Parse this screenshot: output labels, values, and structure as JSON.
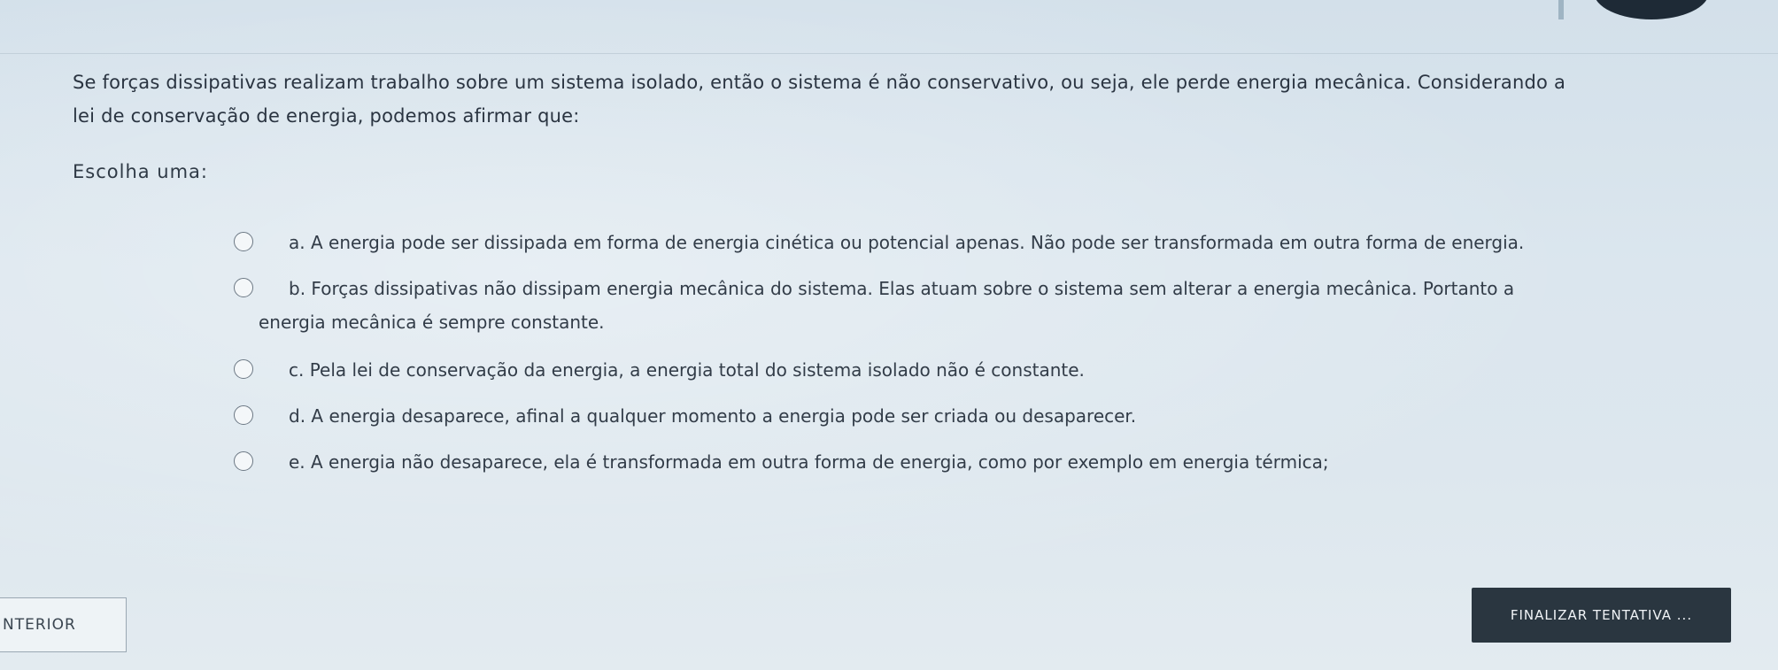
{
  "question": {
    "text_line1": "Se forças dissipativas realizam trabalho sobre um sistema isolado, então o sistema é não conservativo, ou seja, ele perde energia mecânica. Considerando a",
    "text_line2": "lei de conservação de energia, podemos afirmar que:"
  },
  "choose_label": "Escolha uma:",
  "options": [
    {
      "letter": "a",
      "line1": "a. A energia pode ser dissipada em forma de energia cinética ou potencial apenas. Não pode ser transformada em outra forma de energia.",
      "line2": ""
    },
    {
      "letter": "b",
      "line1": "b. Forças dissipativas não dissipam energia mecânica do sistema. Elas atuam sobre o sistema sem alterar a energia mecânica. Portanto a",
      "line2": "energia mecânica é sempre constante."
    },
    {
      "letter": "c",
      "line1": "c. Pela lei de conservação da energia, a energia total do sistema isolado não é constante.",
      "line2": ""
    },
    {
      "letter": "d",
      "line1": "d. A energia desaparece, afinal a qualquer momento a energia pode ser criada ou desaparecer.",
      "line2": ""
    },
    {
      "letter": "e",
      "line1": "e. A energia não desaparece, ela é transformada em outra forma de energia, como por exemplo em energia térmica;",
      "line2": ""
    }
  ],
  "navigation": {
    "previous_label": "NTERIOR",
    "finish_label": "FINALIZAR TENTATIVA ..."
  }
}
